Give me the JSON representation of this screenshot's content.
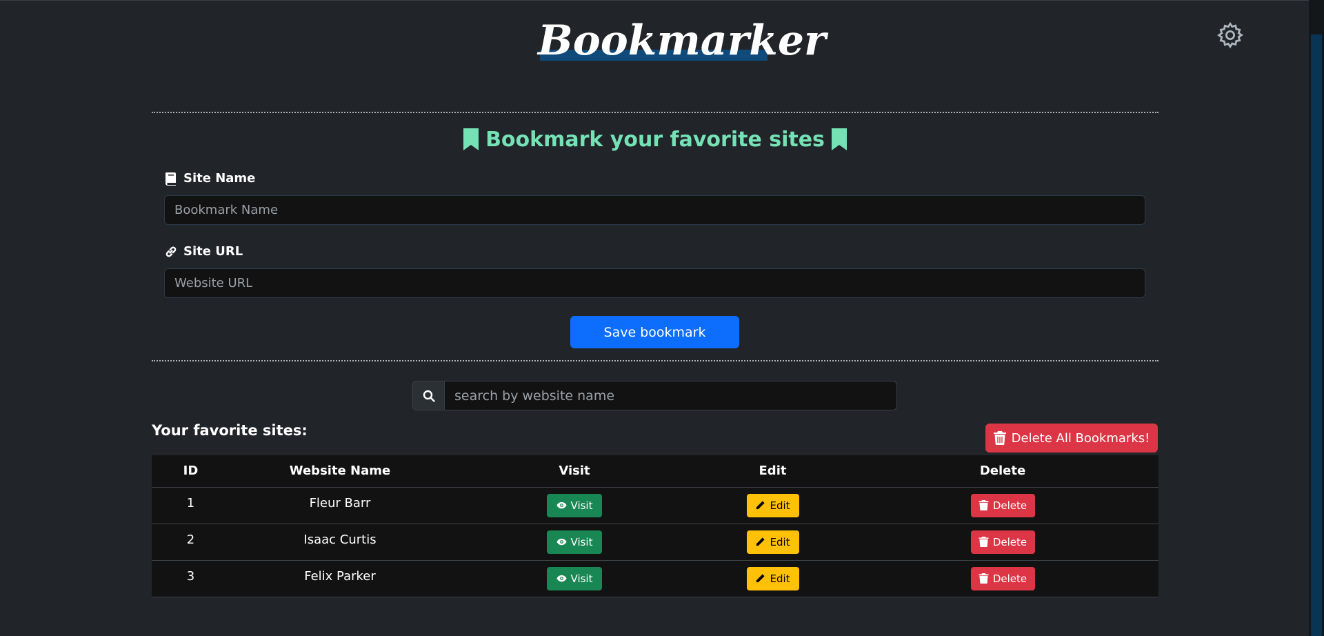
{
  "header": {
    "brand": "Bookmarker"
  },
  "form": {
    "title": "Bookmark your favorite sites",
    "site_name_label": "Site Name",
    "site_name_placeholder": "Bookmark Name",
    "site_url_label": "Site URL",
    "site_url_placeholder": "Website URL",
    "save_label": "Save bookmark"
  },
  "search": {
    "placeholder": "search by website name"
  },
  "list": {
    "title": "Your favorite sites:",
    "delete_all_label": "Delete All Bookmarks!",
    "columns": [
      "ID",
      "Website Name",
      "Visit",
      "Edit",
      "Delete"
    ],
    "rows": [
      {
        "id": "1",
        "name": "Fleur Barr",
        "visit": "Visit",
        "edit": "Edit",
        "delete": "Delete"
      },
      {
        "id": "2",
        "name": "Isaac Curtis",
        "visit": "Visit",
        "edit": "Edit",
        "delete": "Delete"
      },
      {
        "id": "3",
        "name": "Felix Parker",
        "visit": "Visit",
        "edit": "Edit",
        "delete": "Delete"
      }
    ]
  },
  "colors": {
    "background": "#212529",
    "accent_title": "#75e2b6",
    "primary": "#0d6efd",
    "success": "#198754",
    "warning": "#ffc107",
    "danger": "#dc3545"
  },
  "icons": {
    "settings": "gear-icon",
    "title": "bookmark-icon",
    "site_name": "book-icon",
    "site_url": "link-icon",
    "search": "search-icon",
    "delete_all": "trash-icon",
    "visit": "eye-icon",
    "edit": "pencil-icon",
    "delete": "trash-icon"
  }
}
